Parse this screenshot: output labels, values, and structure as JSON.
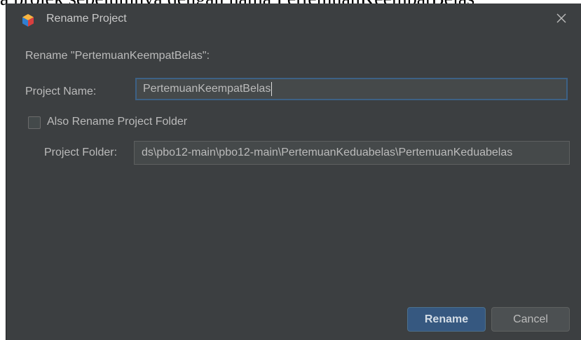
{
  "background_text": "a projek sebelumnya dengan nama PertemuanKeempatBelas",
  "dialog": {
    "title": "Rename Project",
    "app_icon": "netbeans-cube-icon",
    "close_icon": "close-icon",
    "rename_label": "Rename \"PertemuanKeempatBelas\":",
    "project_name_label": "Project Name:",
    "project_name_value": "PertemuanKeempatBelas",
    "also_rename_folder_label": "Also Rename Project Folder",
    "also_rename_folder_checked": false,
    "project_folder_label": "Project Folder:",
    "project_folder_value": "ds\\pbo12-main\\pbo12-main\\PertemuanKeduabelas\\PertemuanKeduabelas",
    "rename_button": "Rename",
    "cancel_button": "Cancel"
  },
  "colors": {
    "dialog_bg": "#3c3f41",
    "field_bg": "#45494a",
    "focus_border": "#3d6185",
    "primary_button": "#365880",
    "text": "#bbbbbb"
  }
}
